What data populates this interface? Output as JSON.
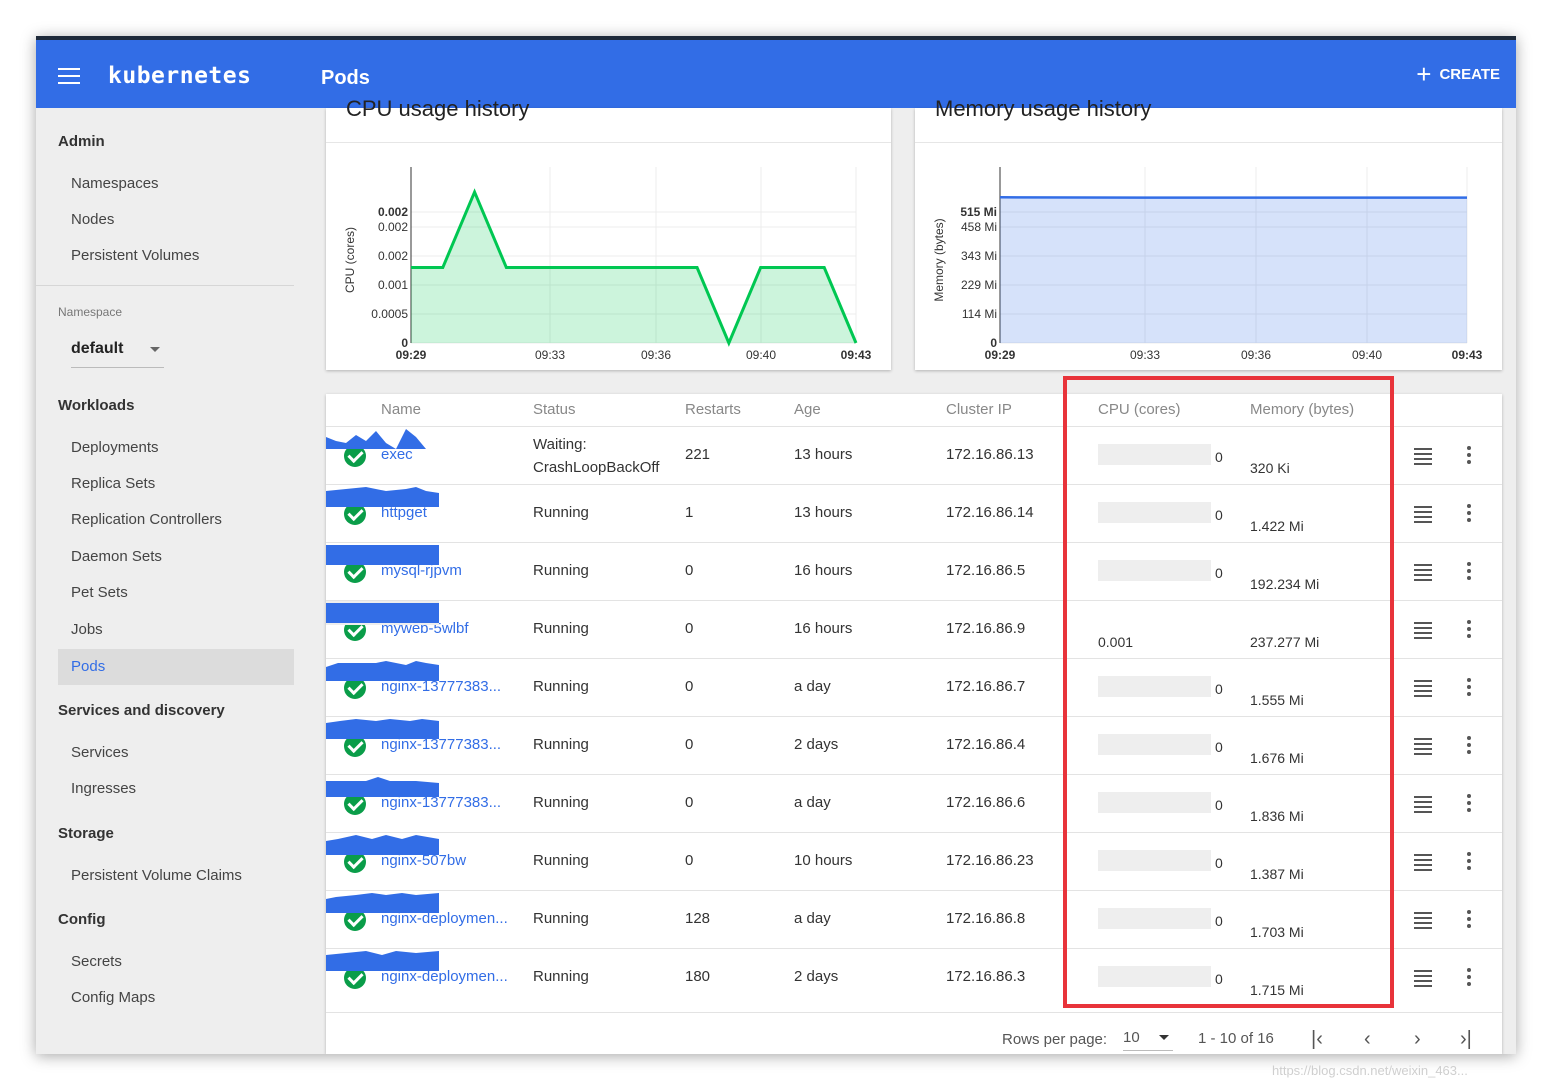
{
  "app": {
    "brand": "kubernetes",
    "page_title": "Pods",
    "create_label": "CREATE"
  },
  "sidebar": {
    "admin": "Admin",
    "admin_items": [
      "Namespaces",
      "Nodes",
      "Persistent Volumes"
    ],
    "namespace_label": "Namespace",
    "namespace_value": "default",
    "workloads": "Workloads",
    "workload_items": [
      "Deployments",
      "Replica Sets",
      "Replication Controllers",
      "Daemon Sets",
      "Pet Sets",
      "Jobs",
      "Pods"
    ],
    "services": "Services and discovery",
    "service_items": [
      "Services",
      "Ingresses"
    ],
    "storage": "Storage",
    "storage_items": [
      "Persistent Volume Claims"
    ],
    "config": "Config",
    "config_items": [
      "Secrets",
      "Config Maps"
    ],
    "active_item": "Pods"
  },
  "cpu_chart": {
    "title": "CPU usage history",
    "ylabel": "CPU (cores)",
    "xlabel": "Time",
    "x_ticks": [
      "09:29",
      "09:33",
      "09:36",
      "09:40",
      "09:43"
    ],
    "y_ticks": [
      "0",
      "0.0005",
      "0.001",
      "0.002",
      "0.002",
      "0.002"
    ]
  },
  "mem_chart": {
    "title": "Memory usage history",
    "ylabel": "Memory (bytes)",
    "xlabel": "Time",
    "x_ticks": [
      "09:29",
      "09:33",
      "09:36",
      "09:40",
      "09:43"
    ],
    "y_ticks": [
      "0",
      "114 Mi",
      "229 Mi",
      "343 Mi",
      "458 Mi",
      "515 Mi"
    ]
  },
  "chart_data": [
    {
      "type": "area",
      "title": "CPU usage history",
      "xlabel": "Time",
      "ylabel": "CPU (cores)",
      "color": "#00c752",
      "x": [
        "09:29",
        "09:30",
        "09:31",
        "09:32",
        "09:33",
        "09:34",
        "09:35",
        "09:36",
        "09:37",
        "09:38",
        "09:39",
        "09:40",
        "09:41",
        "09:42",
        "09:43"
      ],
      "values": [
        0.001,
        0.001,
        0.002,
        0.001,
        0.001,
        0.001,
        0.001,
        0.001,
        0.001,
        0.001,
        0,
        0.001,
        0.001,
        0.001,
        0
      ],
      "ylim": [
        0,
        0.0022
      ]
    },
    {
      "type": "area",
      "title": "Memory usage history",
      "xlabel": "Time",
      "ylabel": "Memory (bytes)",
      "color": "#326de6",
      "x": [
        "09:29",
        "09:33",
        "09:36",
        "09:40",
        "09:43"
      ],
      "values_mi": [
        452,
        451,
        451,
        451,
        451
      ],
      "ylim_mi": [
        0,
        515
      ]
    }
  ],
  "table": {
    "headers": [
      "Name",
      "Status",
      "Restarts",
      "Age",
      "Cluster IP",
      "CPU (cores)",
      "Memory (bytes)"
    ],
    "rows": [
      {
        "name": "exec",
        "status": "Waiting: CrashLoopBackOff",
        "restarts": "221",
        "age": "13 hours",
        "ip": "172.16.86.13",
        "cpu": "0",
        "mem": "320 Ki"
      },
      {
        "name": "httpget",
        "status": "Running",
        "restarts": "1",
        "age": "13 hours",
        "ip": "172.16.86.14",
        "cpu": "0",
        "mem": "1.422 Mi"
      },
      {
        "name": "mysql-rjpvm",
        "status": "Running",
        "restarts": "0",
        "age": "16 hours",
        "ip": "172.16.86.5",
        "cpu": "0",
        "mem": "192.234 Mi"
      },
      {
        "name": "myweb-5wlbf",
        "status": "Running",
        "restarts": "0",
        "age": "16 hours",
        "ip": "172.16.86.9",
        "cpu": "0.001",
        "mem": "237.277 Mi"
      },
      {
        "name": "nginx-13777383...",
        "status": "Running",
        "restarts": "0",
        "age": "a day",
        "ip": "172.16.86.7",
        "cpu": "0",
        "mem": "1.555 Mi"
      },
      {
        "name": "nginx-13777383...",
        "status": "Running",
        "restarts": "0",
        "age": "2 days",
        "ip": "172.16.86.4",
        "cpu": "0",
        "mem": "1.676 Mi"
      },
      {
        "name": "nginx-13777383...",
        "status": "Running",
        "restarts": "0",
        "age": "a day",
        "ip": "172.16.86.6",
        "cpu": "0",
        "mem": "1.836 Mi"
      },
      {
        "name": "nginx-507bw",
        "status": "Running",
        "restarts": "0",
        "age": "10 hours",
        "ip": "172.16.86.23",
        "cpu": "0",
        "mem": "1.387 Mi"
      },
      {
        "name": "nginx-deploymen...",
        "status": "Running",
        "restarts": "128",
        "age": "a day",
        "ip": "172.16.86.8",
        "cpu": "0",
        "mem": "1.703 Mi"
      },
      {
        "name": "nginx-deploymen...",
        "status": "Running",
        "restarts": "180",
        "age": "2 days",
        "ip": "172.16.86.3",
        "cpu": "0",
        "mem": "1.715 Mi"
      }
    ]
  },
  "pagination": {
    "rows_per_page_label": "Rows per page:",
    "rows_per_page": "10",
    "range": "1 - 10 of 16"
  },
  "watermark": "https://blog.csdn.net/weixin_463..."
}
